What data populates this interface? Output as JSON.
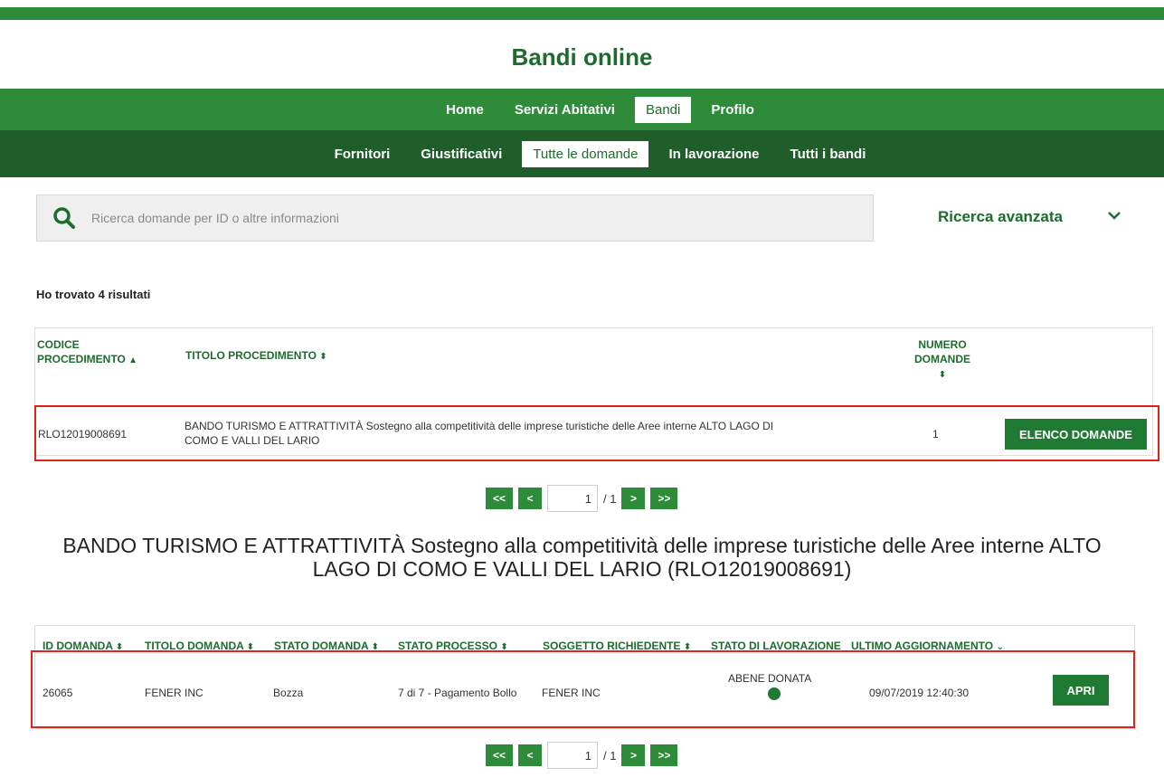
{
  "header": {
    "site_title": "Bandi online",
    "nav_primary": [
      "Home",
      "Servizi Abitativi",
      "Bandi",
      "Profilo"
    ],
    "nav_primary_active": "Bandi",
    "nav_secondary": [
      "Fornitori",
      "Giustificativi",
      "Tutte le domande",
      "In lavorazione",
      "Tutti i bandi"
    ],
    "nav_secondary_active": "Tutte le domande"
  },
  "search": {
    "placeholder": "Ricerca domande per ID o altre informazioni",
    "advanced_label": "Ricerca avanzata"
  },
  "results_text": "Ho trovato 4 risultati",
  "procedures_table": {
    "headers": {
      "codice": [
        "CODICE",
        "PROCEDIMENTO"
      ],
      "titolo": "TITOLO PROCEDIMENTO",
      "numero": [
        "NUMERO",
        "DOMANDE"
      ]
    },
    "row": {
      "codice": "RLO12019008691",
      "titolo_line1": "BANDO TURISMO E ATTRATTIVITÀ Sostegno alla competitività delle imprese turistiche delle Aree interne ALTO LAGO DI",
      "titolo_line2": "COMO E VALLI DEL LARIO",
      "numero": "1",
      "button": "ELENCO DOMANDE"
    }
  },
  "pager": {
    "first": "<<",
    "prev": "<",
    "page": "1",
    "total": "/ 1",
    "next": ">",
    "last": ">>"
  },
  "bando_title_line1": "BANDO TURISMO E ATTRATTIVITÀ Sostegno alla competitività delle imprese turistiche delle Aree interne ALTO",
  "bando_title_line2": "LAGO DI COMO E VALLI DEL LARIO (RLO12019008691)",
  "domande_table": {
    "headers": {
      "id": "ID DOMANDA",
      "titolo": "TITOLO DOMANDA",
      "stato": "STATO DOMANDA",
      "processo": "STATO PROCESSO",
      "soggetto": "SOGGETTO RICHIEDENTE",
      "lavorazione": "STATO DI LAVORAZIONE",
      "aggiornamento": "ULTIMO AGGIORNAMENTO"
    },
    "row": {
      "id": "26065",
      "titolo": "FENER INC",
      "stato": "Bozza",
      "processo": "7 di 7 - Pagamento Bollo",
      "soggetto": "FENER INC",
      "lavorazione": "ABENE DONATA",
      "aggiornamento": "09/07/2019 12:40:30",
      "button": "APRI"
    }
  },
  "colors": {
    "primary_green": "#2e8b3a",
    "dark_green": "#1f5e2a",
    "highlight_red": "#e2231a"
  }
}
